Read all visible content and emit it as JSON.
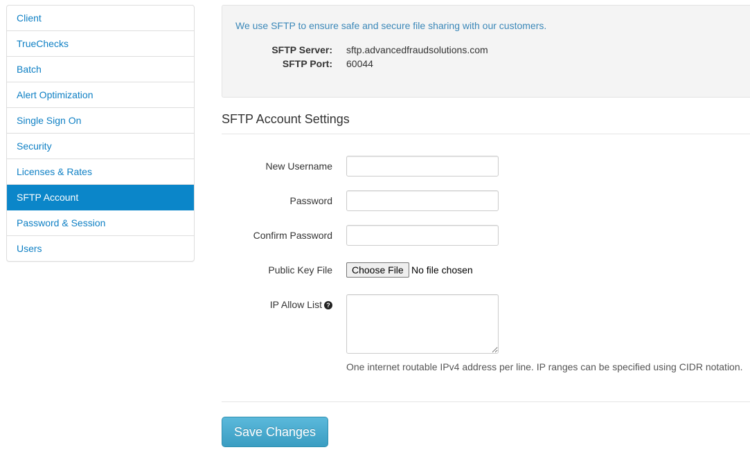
{
  "sidebar": {
    "items": [
      {
        "label": "Client",
        "active": false
      },
      {
        "label": "TrueChecks",
        "active": false
      },
      {
        "label": "Batch",
        "active": false
      },
      {
        "label": "Alert Optimization",
        "active": false
      },
      {
        "label": "Single Sign On",
        "active": false
      },
      {
        "label": "Security",
        "active": false
      },
      {
        "label": "Licenses & Rates",
        "active": false
      },
      {
        "label": "SFTP Account",
        "active": true
      },
      {
        "label": "Password & Session",
        "active": false
      },
      {
        "label": "Users",
        "active": false
      }
    ],
    "active_color": "#0b86c9",
    "link_color": "#0d7fc4"
  },
  "info": {
    "text": "We use SFTP to ensure safe and secure file sharing with our customers.",
    "server_label": "SFTP Server:",
    "server_value": "sftp.advancedfraudsolutions.com",
    "port_label": "SFTP Port:",
    "port_value": "60044"
  },
  "form": {
    "section_title": "SFTP Account Settings",
    "username_label": "New Username",
    "username_value": "",
    "password_label": "Password",
    "password_value": "",
    "confirm_label": "Confirm Password",
    "confirm_value": "",
    "key_file_label": "Public Key File",
    "key_file_button": "Choose File",
    "key_file_status": "No file chosen",
    "ip_label": "IP Allow List",
    "ip_help_icon": "question-circle-icon",
    "ip_value": "",
    "ip_help_text": "One internet routable IPv4 address per line. IP ranges can be specified using CIDR notation.",
    "save_label": "Save Changes"
  }
}
